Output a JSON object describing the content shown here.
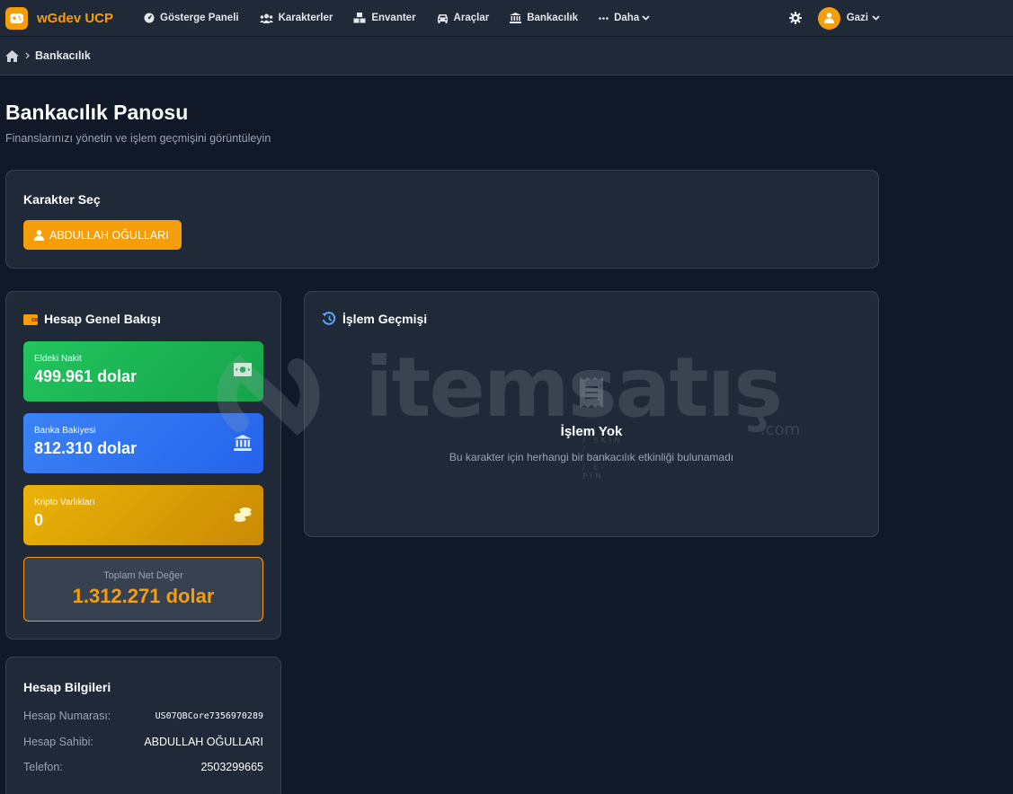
{
  "app": {
    "brand": "wGdev UCP",
    "colors": {
      "accent": "#f59e0b",
      "background": "#111827",
      "surface": "#1f2937",
      "success": "#22c55e",
      "info": "#3b82f6",
      "warning": "#eab308"
    }
  },
  "nav": {
    "items": [
      {
        "label": "Gösterge Paneli",
        "icon": "dashboard-icon"
      },
      {
        "label": "Karakterler",
        "icon": "users-icon"
      },
      {
        "label": "Envanter",
        "icon": "boxes-icon"
      },
      {
        "label": "Araçlar",
        "icon": "car-icon"
      },
      {
        "label": "Bankacılık",
        "icon": "bank-icon"
      },
      {
        "label": "Daha",
        "icon": "ellipsis-icon"
      }
    ],
    "user": {
      "name": "Gazi"
    }
  },
  "breadcrumb": {
    "current": "Bankacılık"
  },
  "page": {
    "title": "Bankacılık Panosu",
    "subtitle": "Finanslarınızı yönetin ve işlem geçmişini görüntüleyin"
  },
  "character_select": {
    "title": "Karakter Seç",
    "selected": "ABDULLAH OĞULLARI"
  },
  "overview": {
    "title": "Hesap Genel Bakışı",
    "cash": {
      "label": "Eldeki Nakit",
      "value": "499.961 dolar"
    },
    "bank": {
      "label": "Banka Bakiyesi",
      "value": "812.310 dolar"
    },
    "crypto": {
      "label": "Kripto Varlıkları",
      "value": "0"
    },
    "networth": {
      "label": "Toplam Net Değer",
      "value": "1.312.271 dolar"
    }
  },
  "history": {
    "title": "İşlem Geçmişi",
    "empty_title": "İşlem Yok",
    "empty_desc": "Bu karakter için herhangi bir bankacılık etkinliği bulunamadı"
  },
  "account_info": {
    "title": "Hesap Bilgileri",
    "rows": [
      {
        "key": "Hesap Numarası:",
        "value": "US07QBCore7356970289"
      },
      {
        "key": "Hesap Sahibi:",
        "value": "ABDULLAH OĞULLARI"
      },
      {
        "key": "Telefon:",
        "value": "2503299665"
      }
    ]
  },
  "watermark": {
    "brand": "itemsatış",
    "tagline": "HESAP / SKIN / ITEM / E-PIN",
    "suffix": ".com"
  }
}
